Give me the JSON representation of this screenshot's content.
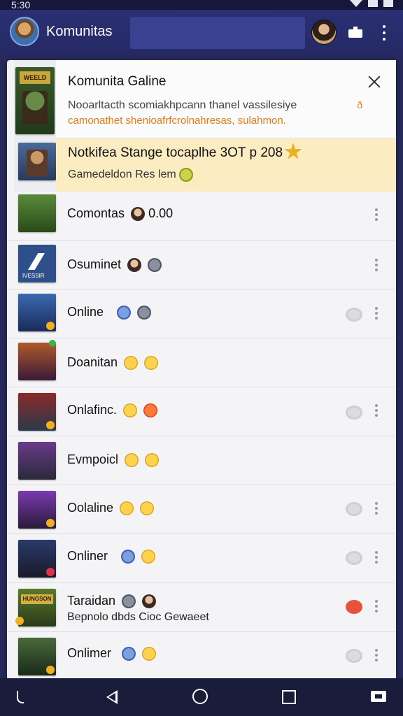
{
  "status_bar": {
    "time": "5:30"
  },
  "app_bar": {
    "title": "Komunitas",
    "search_placeholder": ""
  },
  "dialog": {
    "title": "Komunita Galine",
    "body": "Nooarltacth scomiakhpcann thanel vassilesiye",
    "body_accent": "camonathet shenioafrfcrolnahresas, sulahmon.",
    "badge": "ð"
  },
  "notice": {
    "title": "Notkifea Stange tocaplhe 3OT p 208",
    "subtitle": "Gamedeldon Res lem"
  },
  "rows": [
    {
      "label": "Comontas",
      "suffix": "0.00",
      "toggle": false
    },
    {
      "label": "Osuminet",
      "toggle": false
    },
    {
      "label": "Online",
      "toggle": true
    },
    {
      "label": "Doanitan",
      "toggle": false
    },
    {
      "label": "Onlafinc.",
      "toggle": true
    },
    {
      "label": "Evmpoicl",
      "toggle": false
    },
    {
      "label": "Oolaline",
      "toggle": true
    },
    {
      "label": "Onliner",
      "toggle": true
    },
    {
      "label": "Taraidan",
      "sub": "Bepnolo dbds Cioc Gewaeet",
      "toggle": true,
      "toggle_red": true
    },
    {
      "label": "Onlimer",
      "toggle": true
    }
  ],
  "thumb_labels": {
    "first": "WEELD",
    "second": "IVESSIR",
    "fifth": "HUNGSON"
  },
  "colors": {
    "app_bar": "#2a2f73",
    "notice_bg": "#fcecc2",
    "accent_orange": "#e07a1a",
    "toggle_red": "#e6533a"
  }
}
